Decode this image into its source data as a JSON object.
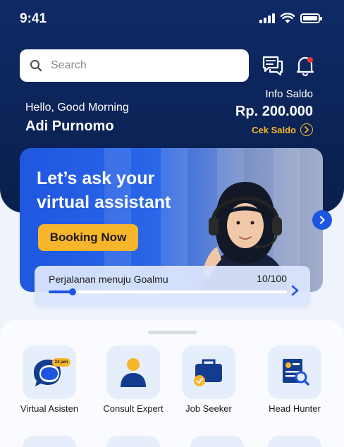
{
  "status_bar": {
    "time": "9:41"
  },
  "search": {
    "placeholder": "Search"
  },
  "greeting": {
    "salutation": "Hello, Good Morning",
    "name": "Adi Purnomo"
  },
  "balance": {
    "label": "Info Saldo",
    "amount": "Rp. 200.000",
    "check_label": "Cek Saldo"
  },
  "banner": {
    "title": "Let’s ask your virtual assistant",
    "button_label": "Booking Now"
  },
  "goal": {
    "label": "Perjalanan menuju Goalmu",
    "count": "10/100",
    "progress": 0.1
  },
  "menu": {
    "items": [
      {
        "label": "Virtual Asisten",
        "icon": "virtual-assistant-icon",
        "badge": "24 jam"
      },
      {
        "label": "Consult Expert",
        "icon": "person-icon"
      },
      {
        "label": "Job Seeker",
        "icon": "briefcase-icon"
      },
      {
        "label": "Head Hunter",
        "icon": "resume-search-icon"
      }
    ]
  },
  "colors": {
    "primary_dark": "#0e2a66",
    "accent": "#f7b52c",
    "brand_blue": "#1e55e0",
    "notification": "#e53935"
  }
}
